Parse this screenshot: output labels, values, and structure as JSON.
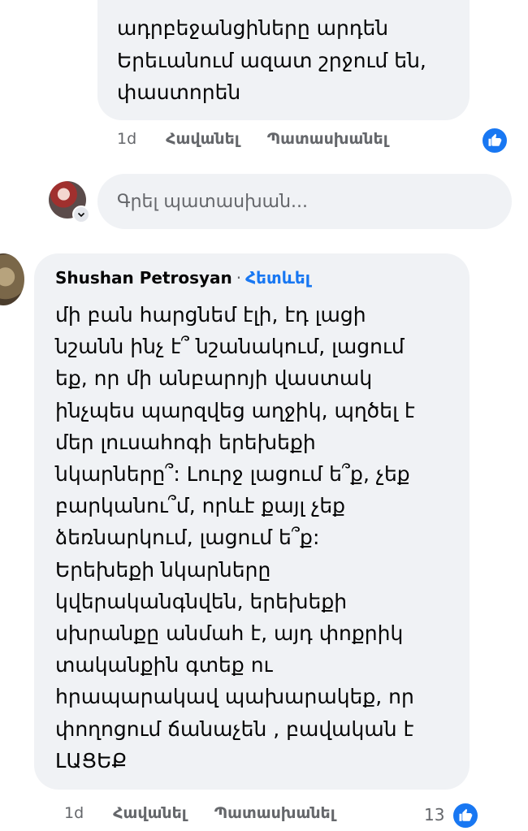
{
  "comment1": {
    "lines": [
      "ադրբեջանցիները արդեն",
      "Երեւանում ազատ շրջում են,",
      "փաստորեն"
    ],
    "actions": {
      "time": "1d",
      "like": "Հավանել",
      "reply": "Պատասխանել"
    }
  },
  "reply_box": {
    "placeholder": "Գրել պատասխան..."
  },
  "comment2": {
    "author": "Shushan Petrosyan",
    "separator": "·",
    "follow": "Հետևել",
    "lines": [
      "մի բան հարցնեմ էլի, էդ լացի",
      "նշանն ինչ է՞ նշանակում, լացում",
      "եք, որ մի անբարոյի վաստակ",
      "ինչպես պարզվեց աղջիկ, պղծել է",
      "մեր լուսահոգի երեխեքի",
      "նկարները՞: Լուրջ լացում ե՞ք, չեք",
      "բարկանու՞մ, որևէ քայլ չեք",
      "ձեռնարկում, լացում ե՞ք:",
      "Երեխեքի նկարները",
      "կվերականգնվեն, երեխեքի",
      "սխրանքը անմահ է, այդ փոքրիկ",
      "տականքին գտեք ու",
      "հրապարակավ պախարակեք, որ",
      "փողոցում ճանաչեն , բավական է",
      "ԼԱՑԵՔ"
    ],
    "actions": {
      "time": "1d",
      "like": "Հավանել",
      "reply": "Պատասխանել"
    },
    "reaction_count": "13"
  },
  "colors": {
    "accent": "#1877f2",
    "bubble": "#f0f2f5",
    "muted": "#65676b"
  },
  "icons": {
    "like": "thumbs-up-icon",
    "chevron": "chevron-down-icon"
  }
}
